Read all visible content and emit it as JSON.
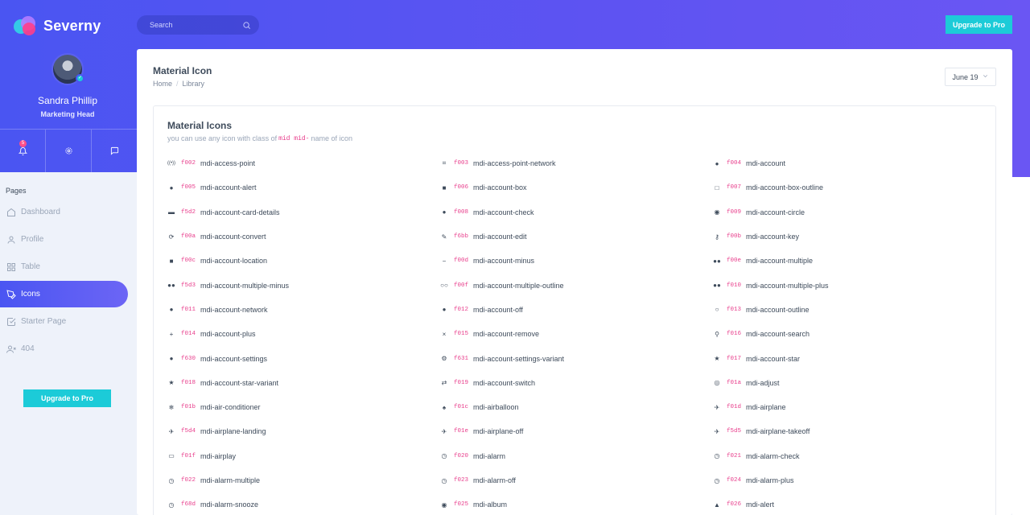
{
  "brand": {
    "name": "Severny"
  },
  "user": {
    "name": "Sandra Phillip",
    "role": "Marketing Head"
  },
  "quick": {
    "notifications_count": "5"
  },
  "search": {
    "placeholder": "Search"
  },
  "top_upgrade_label": "Upgrade to Pro",
  "sidebar": {
    "heading": "Pages",
    "items": [
      {
        "label": "Dashboard",
        "icon": "home-icon",
        "active": false
      },
      {
        "label": "Profile",
        "icon": "user-icon",
        "active": false
      },
      {
        "label": "Table",
        "icon": "table-icon",
        "active": false
      },
      {
        "label": "Icons",
        "icon": "pen-icon",
        "active": true
      },
      {
        "label": "Starter Page",
        "icon": "check-square-icon",
        "active": false
      },
      {
        "label": "404",
        "icon": "user-x-icon",
        "active": false
      }
    ],
    "upgrade_label": "Upgrade to Pro"
  },
  "page": {
    "title": "Material Icon",
    "breadcrumb": [
      "Home",
      "Library"
    ],
    "date_filter": "June 19"
  },
  "icons_section": {
    "title": "Material Icons",
    "subtitle_prefix": "you can use any icon with class of",
    "subtitle_code": "mid mid-",
    "subtitle_suffix": "name of icon",
    "icons": [
      {
        "code": "f002",
        "name": "mdi-access-point",
        "glyph": "((•))"
      },
      {
        "code": "f003",
        "name": "mdi-access-point-network",
        "glyph": "⌗"
      },
      {
        "code": "f004",
        "name": "mdi-account",
        "glyph": "●"
      },
      {
        "code": "f005",
        "name": "mdi-account-alert",
        "glyph": "●"
      },
      {
        "code": "f006",
        "name": "mdi-account-box",
        "glyph": "■"
      },
      {
        "code": "f007",
        "name": "mdi-account-box-outline",
        "glyph": "□"
      },
      {
        "code": "f5d2",
        "name": "mdi-account-card-details",
        "glyph": "▬"
      },
      {
        "code": "f008",
        "name": "mdi-account-check",
        "glyph": "●"
      },
      {
        "code": "f009",
        "name": "mdi-account-circle",
        "glyph": "◉"
      },
      {
        "code": "f00a",
        "name": "mdi-account-convert",
        "glyph": "⟳"
      },
      {
        "code": "f6bb",
        "name": "mdi-account-edit",
        "glyph": "✎"
      },
      {
        "code": "f00b",
        "name": "mdi-account-key",
        "glyph": "⚷"
      },
      {
        "code": "f00c",
        "name": "mdi-account-location",
        "glyph": "■"
      },
      {
        "code": "f00d",
        "name": "mdi-account-minus",
        "glyph": "−"
      },
      {
        "code": "f00e",
        "name": "mdi-account-multiple",
        "glyph": "●●"
      },
      {
        "code": "f5d3",
        "name": "mdi-account-multiple-minus",
        "glyph": "●●"
      },
      {
        "code": "f00f",
        "name": "mdi-account-multiple-outline",
        "glyph": "○○"
      },
      {
        "code": "f010",
        "name": "mdi-account-multiple-plus",
        "glyph": "●●"
      },
      {
        "code": "f011",
        "name": "mdi-account-network",
        "glyph": "●"
      },
      {
        "code": "f012",
        "name": "mdi-account-off",
        "glyph": "●"
      },
      {
        "code": "f013",
        "name": "mdi-account-outline",
        "glyph": "○"
      },
      {
        "code": "f014",
        "name": "mdi-account-plus",
        "glyph": "+"
      },
      {
        "code": "f015",
        "name": "mdi-account-remove",
        "glyph": "×"
      },
      {
        "code": "f016",
        "name": "mdi-account-search",
        "glyph": "⚲"
      },
      {
        "code": "f630",
        "name": "mdi-account-settings",
        "glyph": "●"
      },
      {
        "code": "f631",
        "name": "mdi-account-settings-variant",
        "glyph": "⚙"
      },
      {
        "code": "f017",
        "name": "mdi-account-star",
        "glyph": "★"
      },
      {
        "code": "f018",
        "name": "mdi-account-star-variant",
        "glyph": "★"
      },
      {
        "code": "f019",
        "name": "mdi-account-switch",
        "glyph": "⇄"
      },
      {
        "code": "f01a",
        "name": "mdi-adjust",
        "glyph": "◎"
      },
      {
        "code": "f01b",
        "name": "mdi-air-conditioner",
        "glyph": "❄"
      },
      {
        "code": "f01c",
        "name": "mdi-airballoon",
        "glyph": "♠"
      },
      {
        "code": "f01d",
        "name": "mdi-airplane",
        "glyph": "✈"
      },
      {
        "code": "f5d4",
        "name": "mdi-airplane-landing",
        "glyph": "✈"
      },
      {
        "code": "f01e",
        "name": "mdi-airplane-off",
        "glyph": "✈"
      },
      {
        "code": "f5d5",
        "name": "mdi-airplane-takeoff",
        "glyph": "✈"
      },
      {
        "code": "f01f",
        "name": "mdi-airplay",
        "glyph": "▭"
      },
      {
        "code": "f020",
        "name": "mdi-alarm",
        "glyph": "◷"
      },
      {
        "code": "f021",
        "name": "mdi-alarm-check",
        "glyph": "◷"
      },
      {
        "code": "f022",
        "name": "mdi-alarm-multiple",
        "glyph": "◷"
      },
      {
        "code": "f023",
        "name": "mdi-alarm-off",
        "glyph": "◷"
      },
      {
        "code": "f024",
        "name": "mdi-alarm-plus",
        "glyph": "◷"
      },
      {
        "code": "f68d",
        "name": "mdi-alarm-snooze",
        "glyph": "◷"
      },
      {
        "code": "f025",
        "name": "mdi-album",
        "glyph": "◉"
      },
      {
        "code": "f026",
        "name": "mdi-alert",
        "glyph": "▲"
      }
    ]
  },
  "colors": {
    "primary": "#4a55f2",
    "accent": "#1ccbd8",
    "code": "#e83e8c",
    "background": "#eef2fa"
  }
}
